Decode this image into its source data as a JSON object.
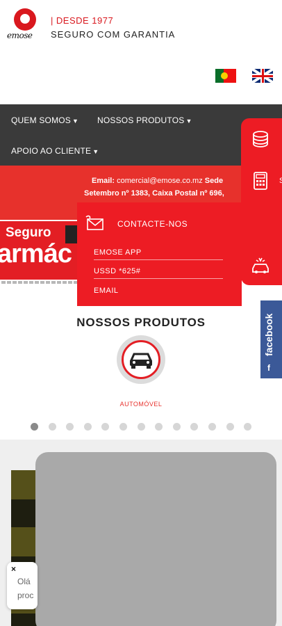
{
  "header": {
    "logo_text": "emose",
    "since": "DESDE 1977",
    "subtitle": "SEGURO COM GARANTIA"
  },
  "nav": {
    "items": [
      "QUEM SOMOS",
      "NOSSOS PRODUTOS",
      "APOIO AO CLIENTE"
    ]
  },
  "contact_bar": {
    "email_label": "Email:",
    "email_value": "comercial@emose.co.mz",
    "sede_label": "Sede",
    "line2": "Setembro nº 1383, Caixa Postal nº 696,"
  },
  "banner": {
    "line1": "Seguro",
    "line2": "armác"
  },
  "popup": {
    "title": "CONTACTE-NOS",
    "links": [
      "EMOSE APP",
      "USSD *625#",
      "EMAIL"
    ]
  },
  "side_panel": {
    "partial_label": "S"
  },
  "facebook": {
    "label": "facebook",
    "icon_letter": "f"
  },
  "products": {
    "title": "NOSSOS PRODUTOS",
    "current_product": "AUTOMÓVEL",
    "slide_count": 13,
    "active_slide": 1
  },
  "chat": {
    "close": "×",
    "line1": "Olá",
    "line2": "proc"
  },
  "colors": {
    "brand_red": "#e7312c",
    "nav_dark": "#3a3a3a",
    "facebook_blue": "#3b5998"
  }
}
